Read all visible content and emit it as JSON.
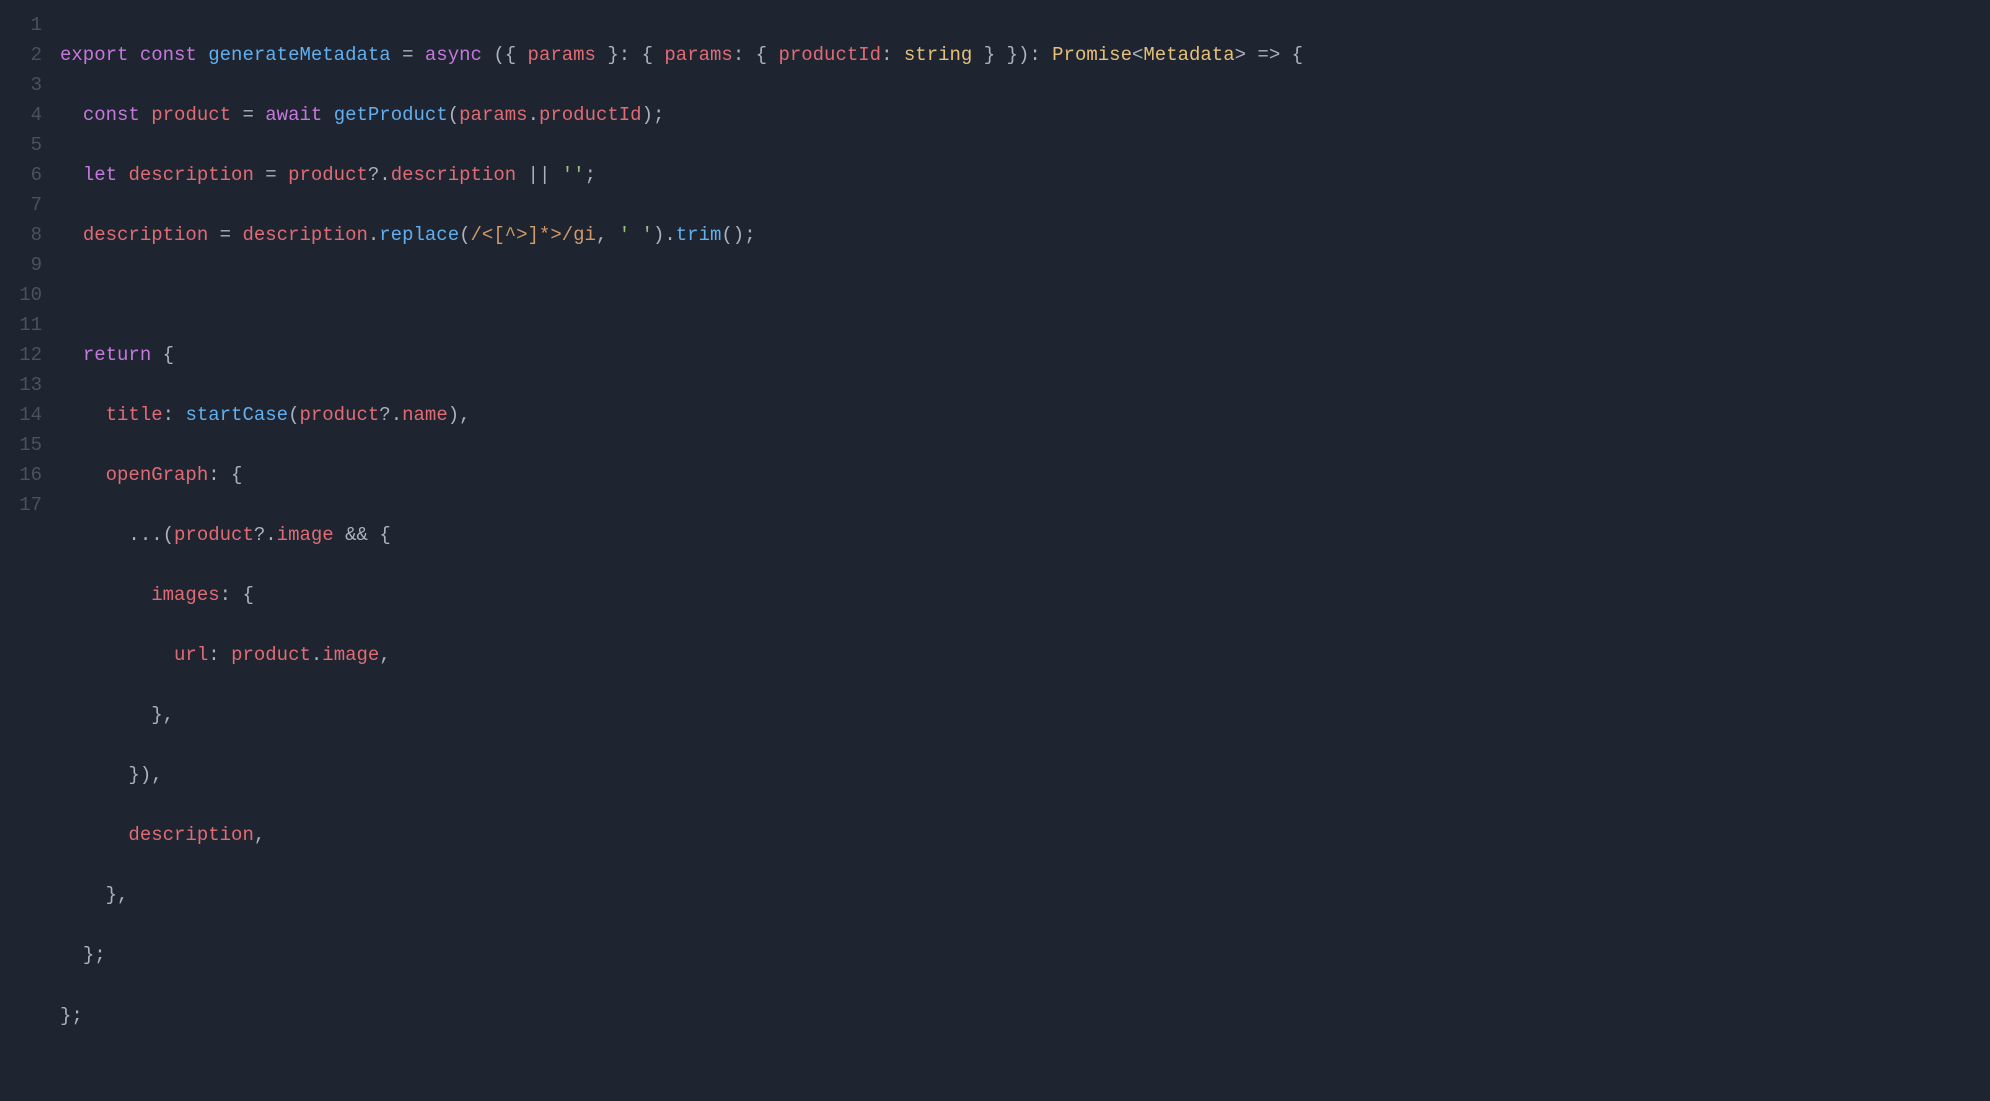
{
  "lineNumbers": [
    "1",
    "2",
    "3",
    "4",
    "5",
    "6",
    "7",
    "8",
    "9",
    "10",
    "11",
    "12",
    "13",
    "14",
    "15",
    "16",
    "17"
  ],
  "tokens": {
    "l1": {
      "t1": "export",
      "t2": " ",
      "t3": "const",
      "t4": " ",
      "t5": "generateMetadata",
      "t6": " ",
      "t7": "=",
      "t8": " ",
      "t9": "async",
      "t10": " ",
      "t11": "(",
      "t12": "{ ",
      "t13": "params",
      "t14": " }",
      "t15": ":",
      "t16": " ",
      "t17": "{ ",
      "t18": "params",
      "t19": ":",
      "t20": " ",
      "t21": "{ ",
      "t22": "productId",
      "t23": ":",
      "t24": " ",
      "t25": "string",
      "t26": " }",
      "t27": " }",
      "t28": ")",
      "t29": ":",
      "t30": " ",
      "t31": "Promise",
      "t32": "<",
      "t33": "Metadata",
      "t34": ">",
      "t35": " ",
      "t36": "=>",
      "t37": " ",
      "t38": "{"
    },
    "l2": {
      "t1": "  ",
      "t2": "const",
      "t3": " ",
      "t4": "product",
      "t5": " ",
      "t6": "=",
      "t7": " ",
      "t8": "await",
      "t9": " ",
      "t10": "getProduct",
      "t11": "(",
      "t12": "params",
      "t13": ".",
      "t14": "productId",
      "t15": ")",
      "t16": ";"
    },
    "l3": {
      "t1": "  ",
      "t2": "let",
      "t3": " ",
      "t4": "description",
      "t5": " ",
      "t6": "=",
      "t7": " ",
      "t8": "product",
      "t9": "?.",
      "t10": "description",
      "t11": " ",
      "t12": "||",
      "t13": " ",
      "t14": "''",
      "t15": ";"
    },
    "l4": {
      "t1": "  ",
      "t2": "description",
      "t3": " ",
      "t4": "=",
      "t5": " ",
      "t6": "description",
      "t7": ".",
      "t8": "replace",
      "t9": "(",
      "t10": "/<[^>]*>/gi",
      "t11": ",",
      "t12": " ",
      "t13": "' '",
      "t14": ")",
      "t15": ".",
      "t16": "trim",
      "t17": "(",
      "t18": ")",
      "t19": ";"
    },
    "l5": {
      "t1": ""
    },
    "l6": {
      "t1": "  ",
      "t2": "return",
      "t3": " ",
      "t4": "{"
    },
    "l7": {
      "t1": "    ",
      "t2": "title",
      "t3": ":",
      "t4": " ",
      "t5": "startCase",
      "t6": "(",
      "t7": "product",
      "t8": "?.",
      "t9": "name",
      "t10": ")",
      "t11": ","
    },
    "l8": {
      "t1": "    ",
      "t2": "openGraph",
      "t3": ":",
      "t4": " ",
      "t5": "{"
    },
    "l9": {
      "t1": "      ",
      "t2": "...(",
      "t3": "product",
      "t4": "?.",
      "t5": "image",
      "t6": " ",
      "t7": "&&",
      "t8": " ",
      "t9": "{"
    },
    "l10": {
      "t1": "        ",
      "t2": "images",
      "t3": ":",
      "t4": " ",
      "t5": "{"
    },
    "l11": {
      "t1": "          ",
      "t2": "url",
      "t3": ":",
      "t4": " ",
      "t5": "product",
      "t6": ".",
      "t7": "image",
      "t8": ","
    },
    "l12": {
      "t1": "        ",
      "t2": "},"
    },
    "l13": {
      "t1": "      ",
      "t2": "}),"
    },
    "l14": {
      "t1": "      ",
      "t2": "description",
      "t3": ","
    },
    "l15": {
      "t1": "    ",
      "t2": "},"
    },
    "l16": {
      "t1": "  ",
      "t2": "};"
    },
    "l17": {
      "t1": "};"
    }
  }
}
